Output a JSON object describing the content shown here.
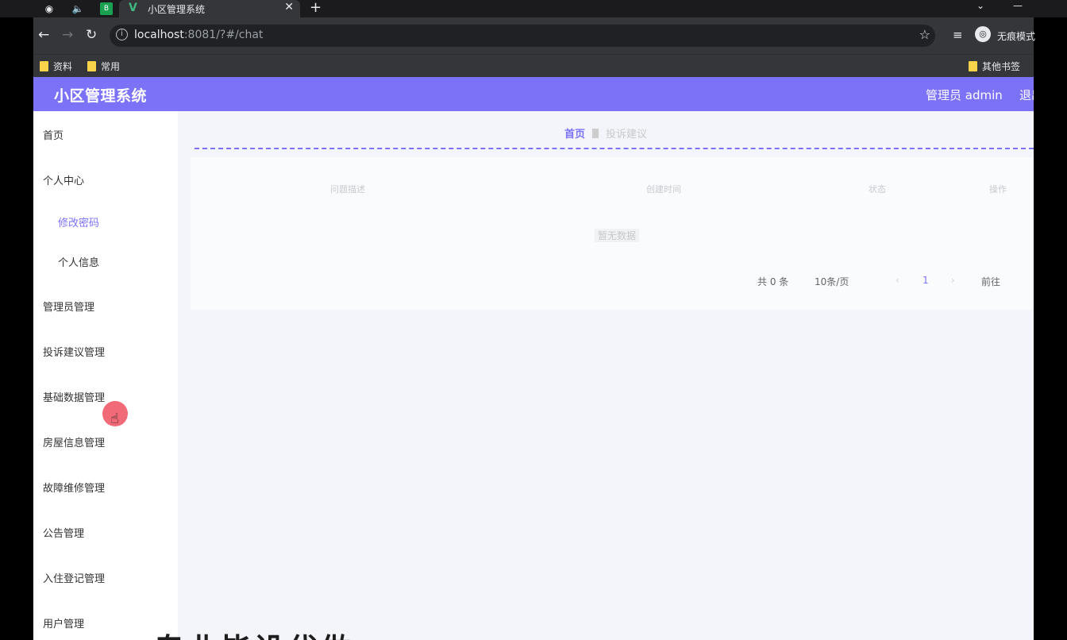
{
  "browser": {
    "tab_title": "小区管理系统",
    "url_host": "localhost",
    "url_rest": ":8081/?#/chat",
    "profile_label": "无痕模式",
    "bookmarks": [
      "资料",
      "常用"
    ],
    "other_bookmarks": "其他书签",
    "icons": [
      "globe-icon",
      "mute-icon",
      "star-icon",
      "close-icon",
      "new-tab-icon",
      "back-icon",
      "forward-icon",
      "reload-icon",
      "info-icon",
      "reading-list-icon",
      "incognito-icon"
    ]
  },
  "app": {
    "brand": "小区管理系统",
    "user": "管理员 admin",
    "logout": "退出",
    "accent_color": "#7b72f7"
  },
  "sidebar": {
    "items": [
      {
        "label": "首页"
      },
      {
        "label": "个人中心"
      },
      {
        "label": "修改密码"
      },
      {
        "label": "个人信息"
      },
      {
        "label": "管理员管理"
      },
      {
        "label": "投诉建议管理"
      },
      {
        "label": "基础数据管理"
      },
      {
        "label": "房屋信息管理"
      },
      {
        "label": "故障维修管理"
      },
      {
        "label": "公告管理"
      },
      {
        "label": "入住登记管理"
      },
      {
        "label": "用户管理"
      }
    ]
  },
  "main": {
    "breadcrumb_home": "首页",
    "breadcrumb_current": "投诉建议",
    "table_headers": [
      "问题描述",
      "创建时间",
      "状态",
      "操作"
    ],
    "empty_text": "暂无数据",
    "pager": {
      "total": "共 0 条",
      "size": "10条/页",
      "prev": "‹",
      "page": "1",
      "next": "›",
      "goto": "前往"
    }
  },
  "watermark": "专业毕设代做"
}
